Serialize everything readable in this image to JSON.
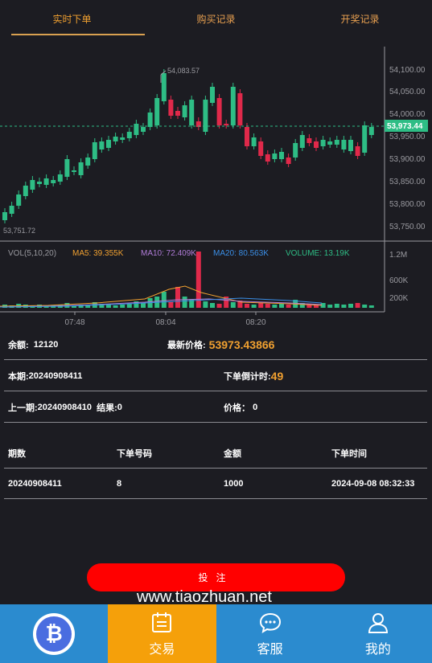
{
  "tabs": [
    {
      "label": "实时下单"
    },
    {
      "label": "购买记录"
    },
    {
      "label": "开奖记录"
    }
  ],
  "chart_data": {
    "type": "candlestick",
    "price_ticks": [
      "54,100.00",
      "54,050.00",
      "54,000.00",
      "53,950.00",
      "53,900.00",
      "53,850.00",
      "53,800.00",
      "53,750.00"
    ],
    "current_price_label": "53,973.44",
    "high_label": "54,083.57",
    "low_label": "53,751.72",
    "volume_ticks": [
      "1.2M",
      "600K",
      "200K"
    ],
    "time_ticks": [
      "07:48",
      "08:04",
      "08:20"
    ],
    "indicators": {
      "vol": "VOL(5,10,20)",
      "ma5": "MA5: 39.355K",
      "ma10": "MA10: 72.409K",
      "ma20": "MA20: 80.563K",
      "volume": "VOLUME: 13.19K"
    },
    "colors": {
      "up": "#2ebd85",
      "down": "#e0294a",
      "ma5": "#f0a030",
      "ma10": "#b07cd8",
      "ma20": "#3a8ee6",
      "volume": "#2ebd85"
    }
  },
  "balance": {
    "label": "余额:",
    "value": "12120"
  },
  "latest_price": {
    "label": "最新价格:",
    "value": "53973.43866"
  },
  "current_period": {
    "label": "本期:",
    "value": "20240908411"
  },
  "countdown": {
    "label": "下单倒计时:",
    "value": "49"
  },
  "prev_period": {
    "label": "上一期:",
    "value": "20240908410",
    "result_label": "结果:",
    "result_value": "0"
  },
  "price": {
    "label": "价格：",
    "value": "0"
  },
  "orders": {
    "headers": [
      "期数",
      "下单号码",
      "金额",
      "下单时间"
    ],
    "rows": [
      [
        "20240908411",
        "8",
        "1000",
        "2024-09-08 08:32:33"
      ]
    ]
  },
  "bet_button": "投注",
  "watermark": "www.tiaozhuan.net",
  "nav": [
    {
      "label": "",
      "icon": "bitcoin-logo"
    },
    {
      "label": "交易",
      "icon": "calendar-icon"
    },
    {
      "label": "客服",
      "icon": "chat-icon"
    },
    {
      "label": "我的",
      "icon": "user-icon"
    }
  ]
}
